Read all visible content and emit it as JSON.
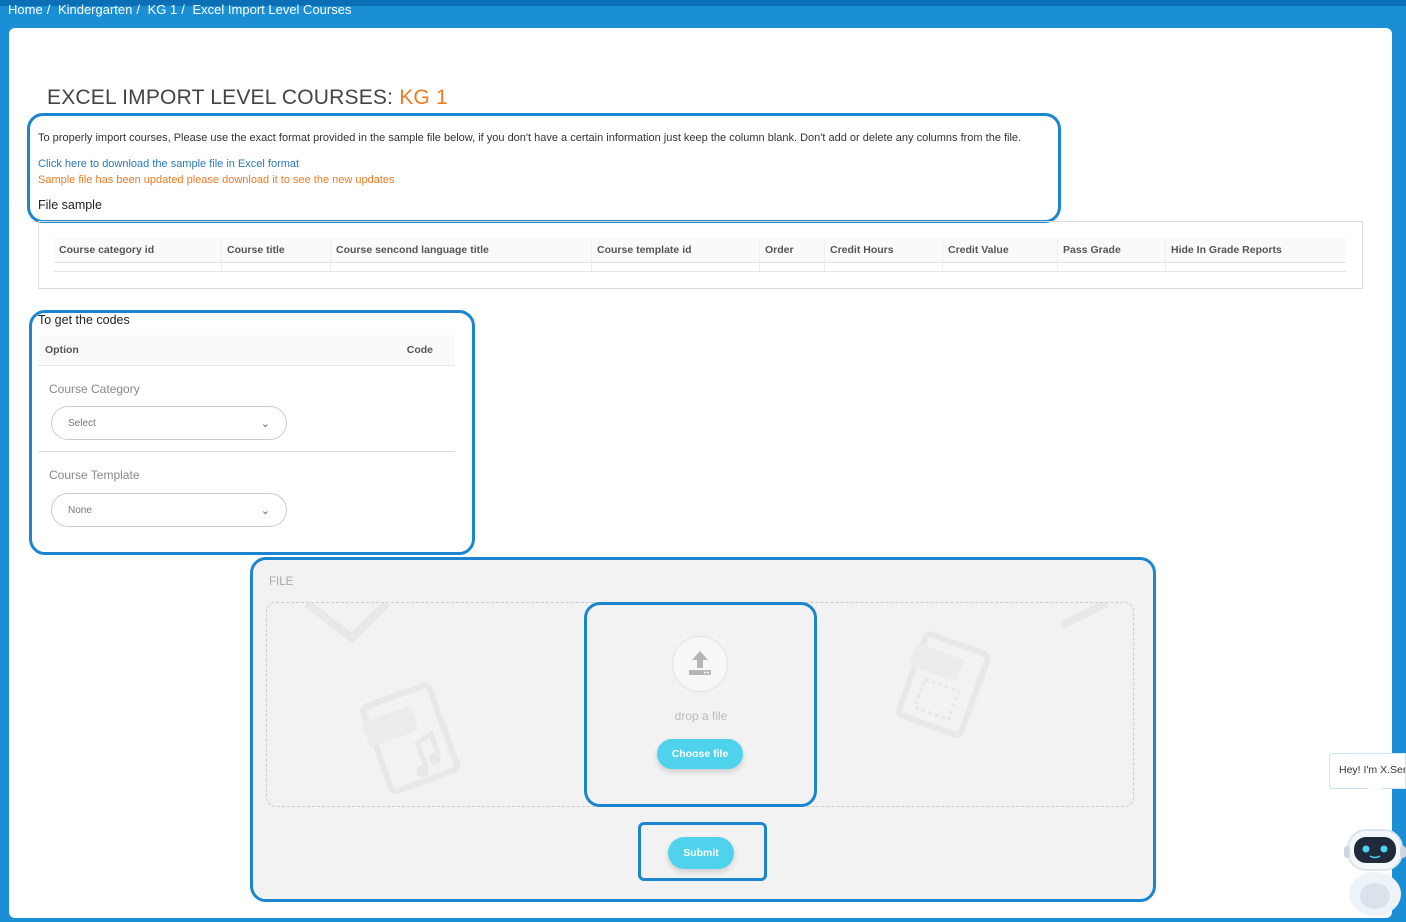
{
  "breadcrumb": {
    "items": [
      "Home",
      "/",
      "Kindergarten",
      "/",
      "KG 1",
      "/",
      "Excel Import Level Courses"
    ]
  },
  "header": {
    "title_prefix": "EXCEL IMPORT LEVEL COURSES: ",
    "title_level": "KG 1",
    "accent_color": "#f07b22"
  },
  "instructions": {
    "text": "To properly import courses, Please use the exact format provided in the sample file below, if you don't have a certain information just keep the column blank. Don't add or delete any columns from the file.",
    "download_link": "Click here to download the sample file in Excel format",
    "update_notice": "Sample file has been updated please download it to see the new updates"
  },
  "file_sample": {
    "title": "File sample",
    "columns": [
      "Course category id",
      "Course title",
      "Course sencond language title",
      "Course template id",
      "Order",
      "Credit Hours",
      "Credit Value",
      "Pass Grade",
      "Hide In Grade Reports"
    ]
  },
  "codes": {
    "title": "To get the codes",
    "col_option": "Option",
    "col_code": "Code",
    "course_category_label": "Course Category",
    "course_category_value": "Select",
    "course_template_label": "Course Template",
    "course_template_value": "None"
  },
  "upload": {
    "label": "FILE",
    "drop_text": "drop a file",
    "choose_label": "Choose file",
    "submit_label": "Submit",
    "button_color": "#4fd3ec"
  },
  "assistant": {
    "greeting": "Hey! I'm X.Ser"
  }
}
